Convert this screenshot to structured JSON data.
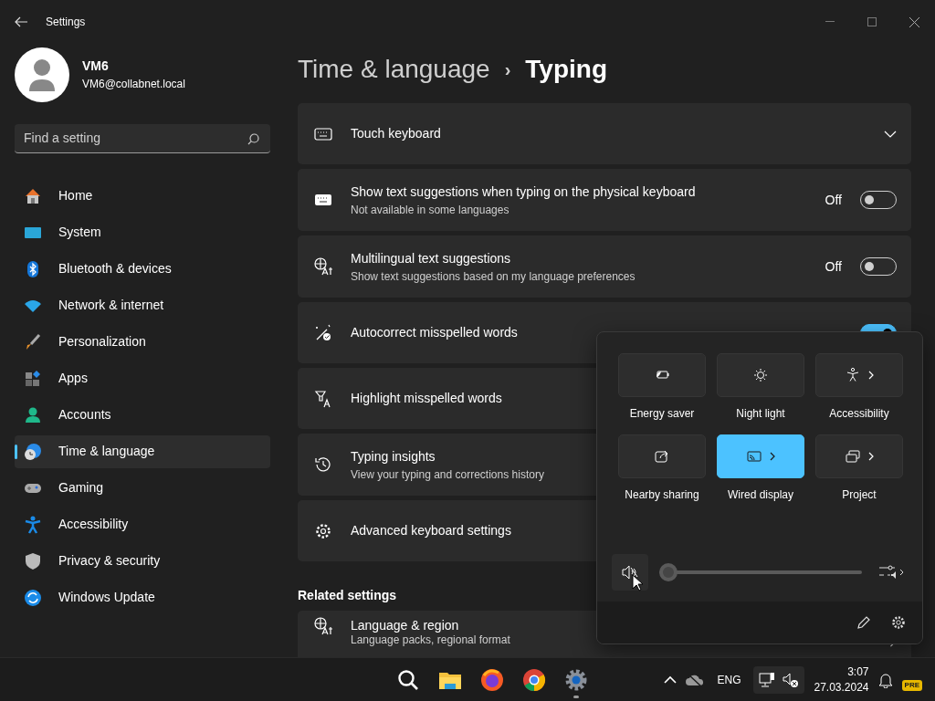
{
  "window": {
    "title": "Settings"
  },
  "account": {
    "name": "VM6",
    "email": "VM6@collabnet.local"
  },
  "search": {
    "placeholder": "Find a setting"
  },
  "sidebar": {
    "items": [
      {
        "label": "Home",
        "selected": false
      },
      {
        "label": "System",
        "selected": false
      },
      {
        "label": "Bluetooth & devices",
        "selected": false
      },
      {
        "label": "Network & internet",
        "selected": false
      },
      {
        "label": "Personalization",
        "selected": false
      },
      {
        "label": "Apps",
        "selected": false
      },
      {
        "label": "Accounts",
        "selected": false
      },
      {
        "label": "Time & language",
        "selected": true
      },
      {
        "label": "Gaming",
        "selected": false
      },
      {
        "label": "Accessibility",
        "selected": false
      },
      {
        "label": "Privacy & security",
        "selected": false
      },
      {
        "label": "Windows Update",
        "selected": false
      }
    ]
  },
  "breadcrumb": {
    "parent": "Time & language",
    "separator": "›",
    "current": "Typing"
  },
  "settings": [
    {
      "kind": "expander",
      "title": "Touch keyboard"
    },
    {
      "kind": "toggle",
      "title": "Show text suggestions when typing on the physical keyboard",
      "subtitle": "Not available in some languages",
      "state_label": "Off",
      "on": false
    },
    {
      "kind": "toggle",
      "title": "Multilingual text suggestions",
      "subtitle": "Show text suggestions based on my language preferences",
      "state_label": "Off",
      "on": false
    },
    {
      "kind": "toggle",
      "title": "Autocorrect misspelled words",
      "on": true
    },
    {
      "kind": "plain",
      "title": "Highlight misspelled words"
    },
    {
      "kind": "plain",
      "title": "Typing insights",
      "subtitle": "View your typing and corrections history"
    },
    {
      "kind": "plain",
      "title": "Advanced keyboard settings"
    }
  ],
  "related": {
    "heading": "Related settings",
    "items": [
      {
        "kind": "link",
        "title": "Language & region",
        "subtitle": "Language packs, regional format"
      }
    ]
  },
  "quick_settings": {
    "tiles": [
      {
        "label": "Energy saver",
        "on": false,
        "has_more": false
      },
      {
        "label": "Night light",
        "on": false,
        "has_more": false
      },
      {
        "label": "Accessibility",
        "on": false,
        "has_more": true
      },
      {
        "label": "Nearby sharing",
        "on": false,
        "has_more": false
      },
      {
        "label": "Wired display",
        "on": true,
        "has_more": true
      },
      {
        "label": "Project",
        "on": false,
        "has_more": true
      }
    ],
    "volume": {
      "muted": true,
      "level": 0
    }
  },
  "taskbar": {
    "language": "ENG",
    "time": "3:07",
    "date": "27.03.2024",
    "badge": "PRE"
  }
}
